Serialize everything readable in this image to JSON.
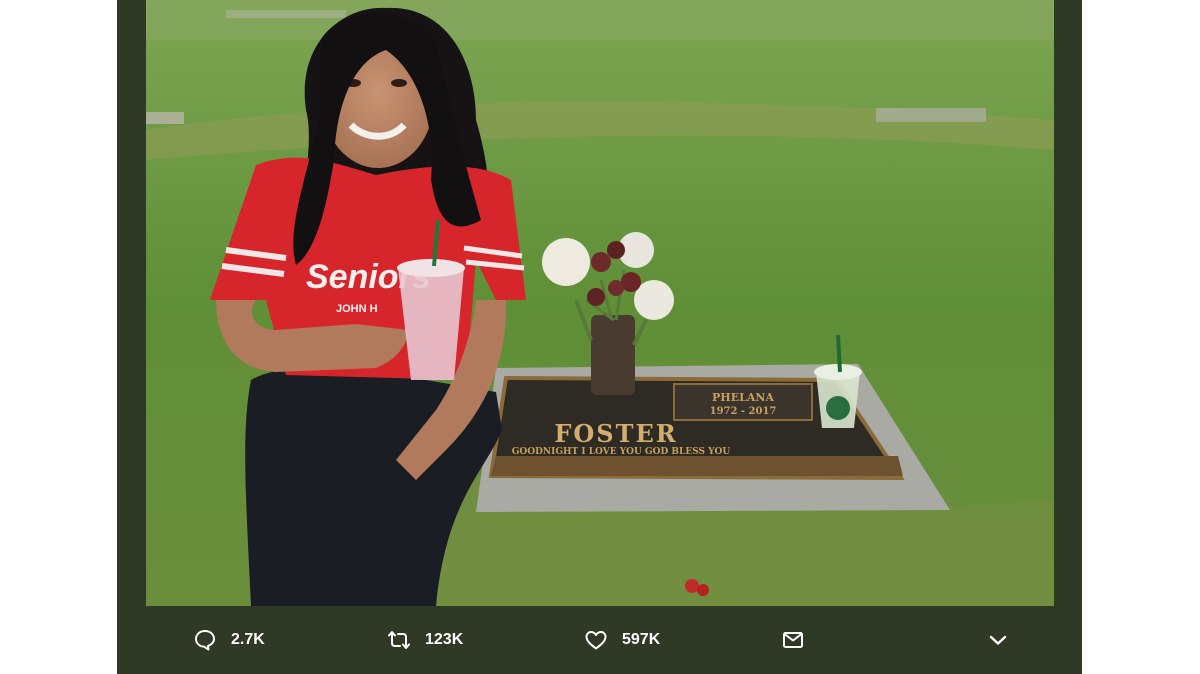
{
  "photo": {
    "headstone": {
      "surname": "FOSTER",
      "first_name": "PHELANA",
      "years": "1972 - 2017",
      "epitaph": "GOODNIGHT I LOVE YOU GOD BLESS YOU"
    },
    "shirt_text": "Seniors",
    "shirt_subtext": "JOHN H"
  },
  "actions": {
    "reply": {
      "icon": "reply-icon",
      "count": "2.7K"
    },
    "retweet": {
      "icon": "retweet-icon",
      "count": "123K"
    },
    "like": {
      "icon": "heart-icon",
      "count": "597K"
    },
    "dm": {
      "icon": "mail-icon"
    },
    "more": {
      "icon": "chevron-down-icon"
    }
  },
  "colors": {
    "frame": "#2f3a26",
    "grass": "#5f8d3a",
    "shirt": "#d7262b"
  }
}
